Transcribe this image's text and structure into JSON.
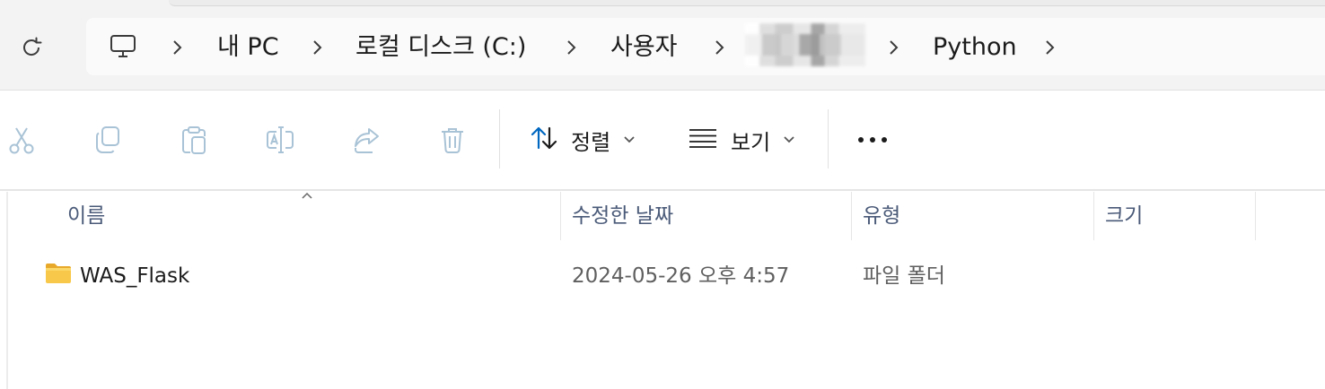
{
  "address_bar": {
    "crumbs": [
      "내 PC",
      "로컬 디스크 (C:)",
      "사용자",
      "Python"
    ],
    "icons": {
      "refresh": "refresh-icon",
      "this_pc": "monitor-icon",
      "separator": "chevron-right-icon"
    }
  },
  "command_bar": {
    "sort_label": "정렬",
    "view_label": "보기",
    "icons": [
      "cut-icon",
      "copy-icon",
      "paste-icon",
      "rename-icon",
      "share-icon",
      "delete-icon",
      "sort-icon",
      "view-icon",
      "more-icon"
    ]
  },
  "file_list": {
    "columns": [
      "이름",
      "수정한 날짜",
      "유형",
      "크기"
    ],
    "rows": [
      {
        "name": "WAS_Flask",
        "modified": "2024-05-26 오후 4:57",
        "type": "파일 폴더",
        "size": ""
      }
    ]
  },
  "colors": {
    "accent": "#0067c0",
    "disabled_icon": "#a9c3d6",
    "header_text": "#4a5a78",
    "folder": "#f8c84a"
  }
}
